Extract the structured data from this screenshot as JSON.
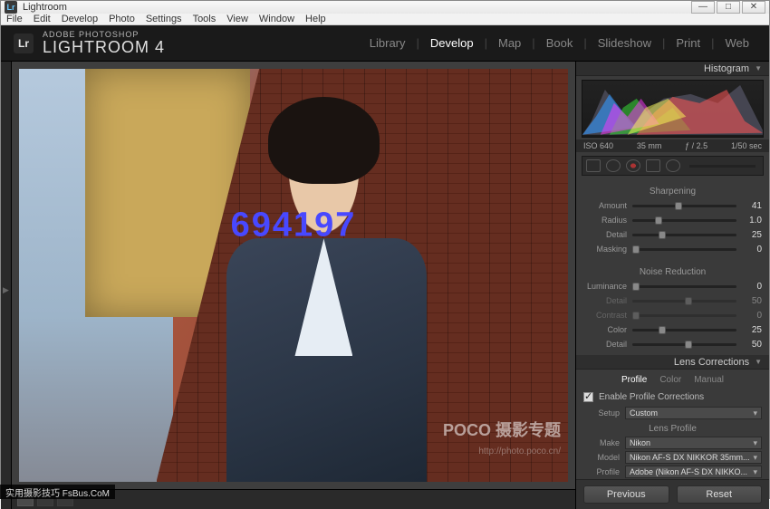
{
  "window": {
    "title": "Lightroom"
  },
  "menus": [
    "File",
    "Edit",
    "Develop",
    "Photo",
    "Settings",
    "Tools",
    "View",
    "Window",
    "Help"
  ],
  "brand": {
    "top": "ADOBE PHOTOSHOP",
    "name": "LIGHTROOM 4"
  },
  "modules": [
    "Library",
    "Develop",
    "Map",
    "Book",
    "Slideshow",
    "Print",
    "Web"
  ],
  "active_module": "Develop",
  "histogram": {
    "title": "Histogram",
    "iso": "ISO 640",
    "focal": "35 mm",
    "aperture": "ƒ / 2.5",
    "shutter": "1/50 sec"
  },
  "sharpening": {
    "title": "Sharpening",
    "rows": [
      {
        "label": "Amount",
        "value": "41",
        "pos": 41
      },
      {
        "label": "Radius",
        "value": "1.0",
        "pos": 22
      },
      {
        "label": "Detail",
        "value": "25",
        "pos": 25
      },
      {
        "label": "Masking",
        "value": "0",
        "pos": 0
      }
    ]
  },
  "noise": {
    "title": "Noise Reduction",
    "rows": [
      {
        "label": "Luminance",
        "value": "0",
        "pos": 0,
        "dim": false
      },
      {
        "label": "Detail",
        "value": "50",
        "pos": 50,
        "dim": true
      },
      {
        "label": "Contrast",
        "value": "0",
        "pos": 0,
        "dim": true
      },
      {
        "label": "Color",
        "value": "25",
        "pos": 25,
        "dim": false
      },
      {
        "label": "Detail",
        "value": "50",
        "pos": 50,
        "dim": false
      }
    ]
  },
  "lens": {
    "title": "Lens Corrections",
    "tabs": [
      "Profile",
      "Color",
      "Manual"
    ],
    "active_tab": "Profile",
    "enable_label": "Enable Profile Corrections",
    "enable_checked": true,
    "setup_label": "Setup",
    "setup_value": "Custom",
    "profile_header": "Lens Profile",
    "make_label": "Make",
    "make_value": "Nikon",
    "model_label": "Model",
    "model_value": "Nikon AF-S DX NIKKOR 35mm...",
    "profile_label": "Profile",
    "profile_value": "Adobe (Nikon AF-S DX NIKKO..."
  },
  "buttons": {
    "previous": "Previous",
    "reset": "Reset"
  },
  "watermark": {
    "main": "POCO 摄影专题",
    "sub": "http://photo.poco.cn/"
  },
  "overlay": "694197",
  "footer_badge": "实用摄影技巧 FsBus.CoM"
}
